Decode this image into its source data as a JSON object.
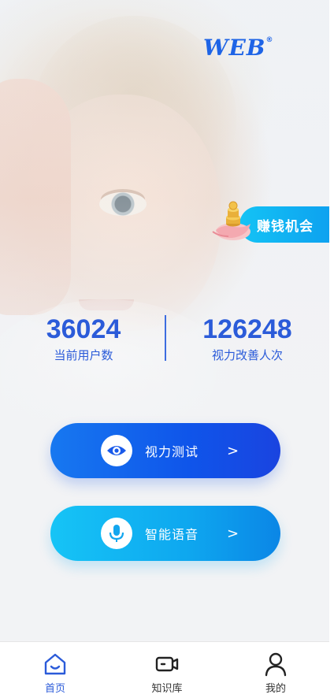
{
  "brand": {
    "logo_text": "WEB",
    "registered_mark": "®",
    "accent_color": "#2b5bd9"
  },
  "promo": {
    "label": "赚钱机会",
    "icon": "hand-coins-icon"
  },
  "stats": {
    "current_users": {
      "value": "36024",
      "label": "当前用户数"
    },
    "vision_improved": {
      "value": "126248",
      "label": "视力改善人次"
    }
  },
  "actions": {
    "vision_test": {
      "label": "视力测试",
      "icon": "eye-icon",
      "chevron": ">"
    },
    "smart_voice": {
      "label": "智能语音",
      "icon": "microphone-icon",
      "chevron": ">"
    }
  },
  "tabbar": {
    "items": [
      {
        "label": "首页",
        "icon": "home-icon",
        "active": true
      },
      {
        "label": "知识库",
        "icon": "video-camera-icon",
        "active": false
      },
      {
        "label": "我的",
        "icon": "user-icon",
        "active": false
      }
    ]
  }
}
